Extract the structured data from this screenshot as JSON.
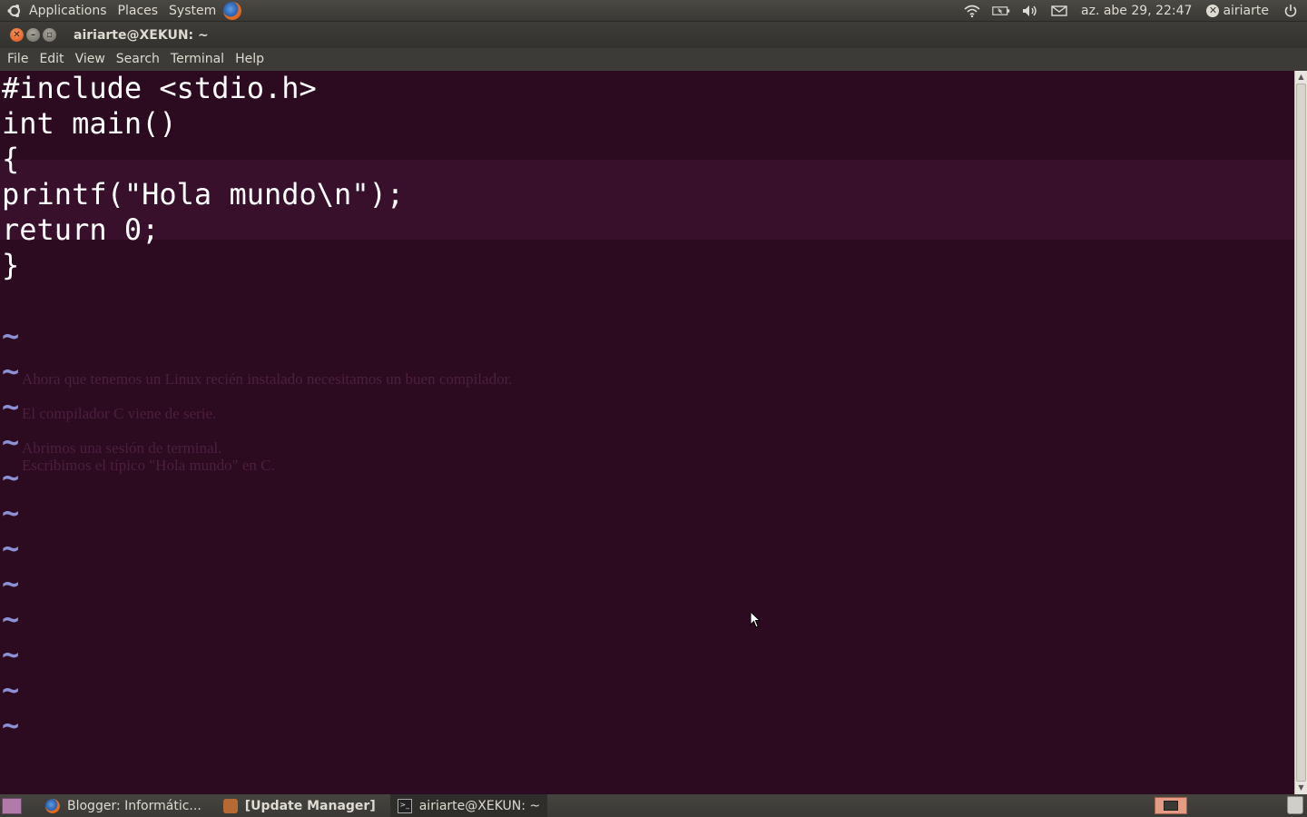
{
  "top_panel": {
    "menus": [
      "Applications",
      "Places",
      "System"
    ],
    "clock": "az. abe 29, 22:47",
    "user": "airiarte",
    "icons": [
      "ubuntu-logo-icon",
      "firefox-icon",
      "wifi-icon",
      "battery-icon",
      "volume-icon",
      "mail-icon",
      "user-status-icon",
      "power-icon"
    ]
  },
  "window": {
    "title": "airiarte@XEKUN: ~",
    "menu": [
      "File",
      "Edit",
      "View",
      "Search",
      "Terminal",
      "Help"
    ]
  },
  "editor": {
    "lines": [
      "#include <stdio.h>",
      "int main()",
      "{",
      "printf(\"Hola mundo\\n\");",
      "return 0;",
      "}"
    ],
    "empty_line_marker": "~",
    "empty_line_count": 12
  },
  "background_ghost": {
    "lines": [
      "Ahora que tenemos un Linux recién instalado necesitamos un buen compilador.",
      "El compilador C viene de serie.",
      "Abrimos una sesión de terminal.",
      "Escribimos el típico \"Hola mundo\" en C."
    ]
  },
  "taskbar": {
    "tasks": [
      {
        "label": "Blogger: Informátic...",
        "bold": false
      },
      {
        "label": "[Update Manager]",
        "bold": true
      },
      {
        "label": "airiarte@XEKUN: ~",
        "bold": false
      }
    ]
  },
  "colors": {
    "terminal_bg": "#2c0a20",
    "code_text": "#ffffff",
    "tilde": "#8c90d4",
    "panel": "#3c3b37"
  }
}
